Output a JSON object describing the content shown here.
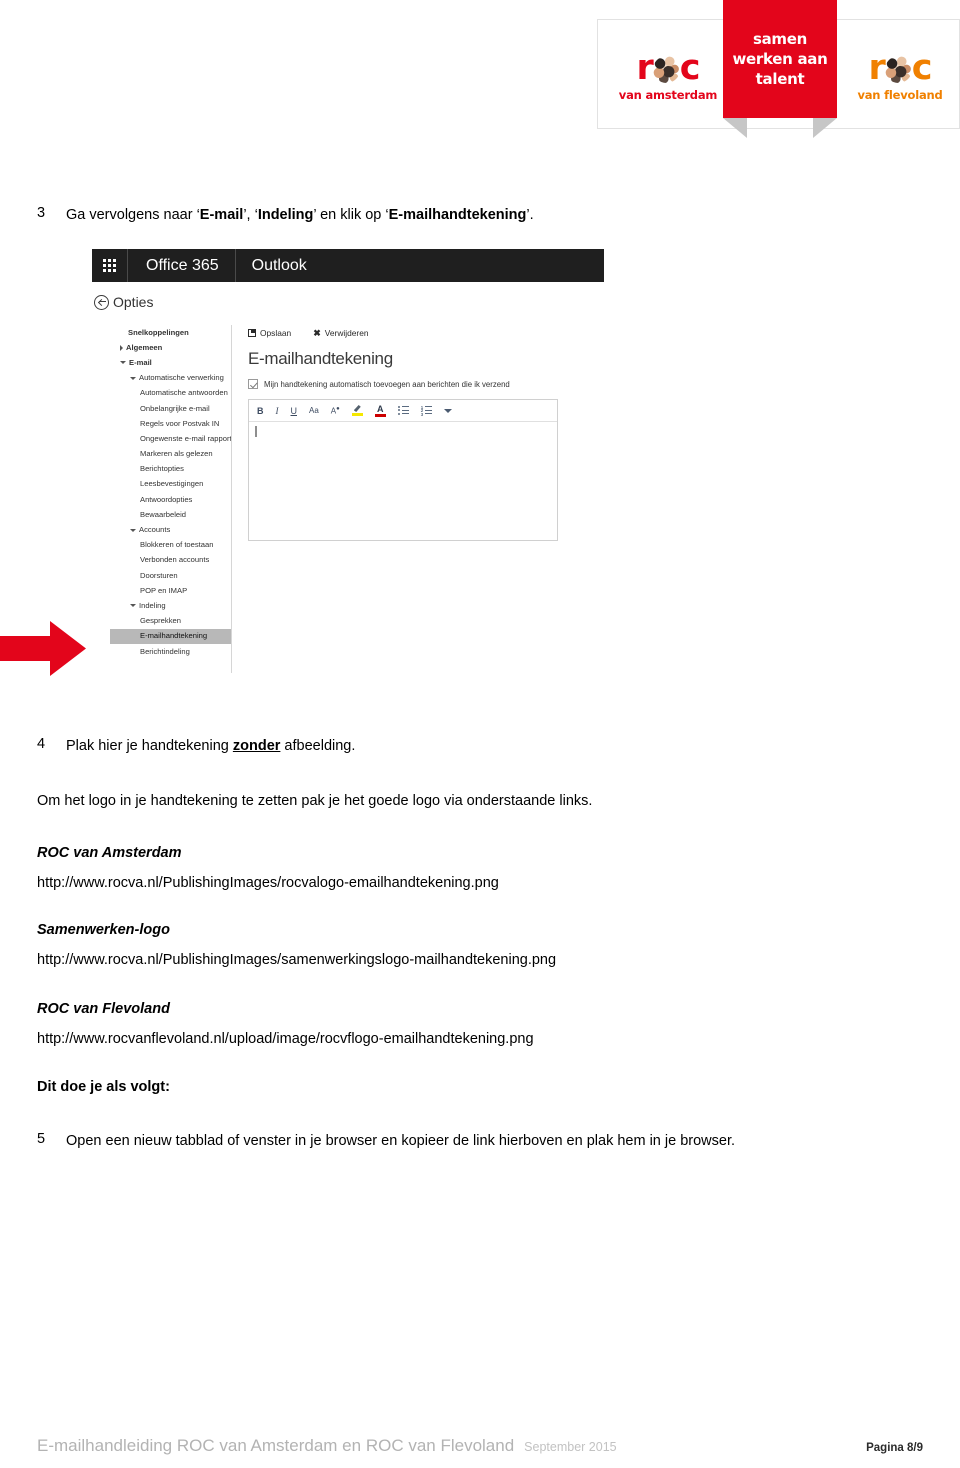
{
  "header": {
    "logo_left": {
      "word": "roc",
      "sub": "van amsterdam",
      "color": "#e3051b"
    },
    "logo_right": {
      "word": "roc",
      "sub": "van flevoland",
      "color": "#f08000"
    },
    "banner": {
      "line1": "samen",
      "line2": "werken aan",
      "line3": "talent",
      "color": "#e3051b"
    }
  },
  "steps": {
    "step3": {
      "number": "3",
      "pre": "Ga vervolgens naar ‘",
      "bold1": "E-mail",
      "mid1": "’, ‘",
      "bold2": "Indeling",
      "mid2": "’ en klik op ‘",
      "bold3": "E-mailhandtekening",
      "post": "’."
    },
    "step4": {
      "number": "4",
      "pre": "Plak hier je handtekening ",
      "bold_underline": "zonder",
      "post": " afbeelding."
    },
    "step5": {
      "number": "5",
      "text": "Open een nieuw tabblad of venster in je browser en kopieer de link hierboven en plak hem in je browser."
    }
  },
  "screenshot": {
    "topbar": {
      "waffle": "app-launcher-icon",
      "suite": "Office 365",
      "app": "Outlook"
    },
    "back_label": "Opties",
    "nav": [
      {
        "label": "Snelkoppelingen",
        "level": 0,
        "caret": "none",
        "selected": false
      },
      {
        "label": "Algemeen",
        "level": 1,
        "caret": "right",
        "selected": false
      },
      {
        "label": "E-mail",
        "level": 1,
        "caret": "down",
        "selected": false
      },
      {
        "label": "Automatische verwerking",
        "level": 2,
        "caret": "down",
        "selected": false
      },
      {
        "label": "Automatische antwoorden",
        "level": 3,
        "caret": "none",
        "selected": false
      },
      {
        "label": "Onbelangrijke e-mail",
        "level": 3,
        "caret": "none",
        "selected": false
      },
      {
        "label": "Regels voor Postvak IN",
        "level": 3,
        "caret": "none",
        "selected": false
      },
      {
        "label": "Ongewenste e-mail rapporteren",
        "level": 3,
        "caret": "none",
        "selected": false
      },
      {
        "label": "Markeren als gelezen",
        "level": 3,
        "caret": "none",
        "selected": false
      },
      {
        "label": "Berichtopties",
        "level": 3,
        "caret": "none",
        "selected": false
      },
      {
        "label": "Leesbevestigingen",
        "level": 3,
        "caret": "none",
        "selected": false
      },
      {
        "label": "Antwoordopties",
        "level": 3,
        "caret": "none",
        "selected": false
      },
      {
        "label": "Bewaarbeleid",
        "level": 3,
        "caret": "none",
        "selected": false
      },
      {
        "label": "Accounts",
        "level": 2,
        "caret": "down",
        "selected": false
      },
      {
        "label": "Blokkeren of toestaan",
        "level": 3,
        "caret": "none",
        "selected": false
      },
      {
        "label": "Verbonden accounts",
        "level": 3,
        "caret": "none",
        "selected": false
      },
      {
        "label": "Doorsturen",
        "level": 3,
        "caret": "none",
        "selected": false
      },
      {
        "label": "POP en IMAP",
        "level": 3,
        "caret": "none",
        "selected": false
      },
      {
        "label": "Indeling",
        "level": 2,
        "caret": "down",
        "selected": false
      },
      {
        "label": "Gesprekken",
        "level": 3,
        "caret": "none",
        "selected": false
      },
      {
        "label": "E-mailhandtekening",
        "level": 3,
        "caret": "none",
        "selected": true
      },
      {
        "label": "Berichtindeling",
        "level": 3,
        "caret": "none",
        "selected": false
      }
    ],
    "commands": {
      "save": "Opslaan",
      "delete": "Verwijderen"
    },
    "pane_title": "E-mailhandtekening",
    "checkbox": {
      "label": "Mijn handtekening automatisch toevoegen aan berichten die ik verzend",
      "checked": true
    },
    "toolbar": [
      {
        "name": "bold-icon",
        "glyph": "B"
      },
      {
        "name": "italic-icon",
        "glyph": "I"
      },
      {
        "name": "underline-icon",
        "glyph": "U"
      },
      {
        "name": "font-size-icon",
        "glyph": "Aa"
      },
      {
        "name": "font-grow-icon",
        "glyph": "A"
      },
      {
        "name": "highlight-icon",
        "glyph": ""
      },
      {
        "name": "font-color-icon",
        "glyph": "A"
      },
      {
        "name": "bulleted-list-icon",
        "glyph": ""
      },
      {
        "name": "numbered-list-icon",
        "glyph": ""
      },
      {
        "name": "more-options-chevron-icon",
        "glyph": ""
      }
    ],
    "editor_value": ""
  },
  "arrow": {
    "name": "red-arrow-pointer",
    "color": "#e3051b"
  },
  "body": {
    "intro": "Om het logo in je handtekening te zetten pak je het goede logo via onderstaande links.",
    "links": [
      {
        "title": "ROC van Amsterdam",
        "url": "http://www.rocva.nl/PublishingImages/rocvalogo-emailhandtekening.png"
      },
      {
        "title": "Samenwerken-logo",
        "url": "http://www.rocva.nl/PublishingImages/samenwerkingslogo-mailhandtekening.png"
      },
      {
        "title": "ROC van Flevoland",
        "url": "http://www.rocvanflevoland.nl/upload/image/rocvflogo-emailhandtekening.png"
      }
    ],
    "howto": "Dit doe je als volgt:"
  },
  "footer": {
    "title": "E-mailhandleiding ROC van Amsterdam en ROC van Flevoland",
    "date": "September 2015",
    "page": "Pagina 8/9"
  }
}
